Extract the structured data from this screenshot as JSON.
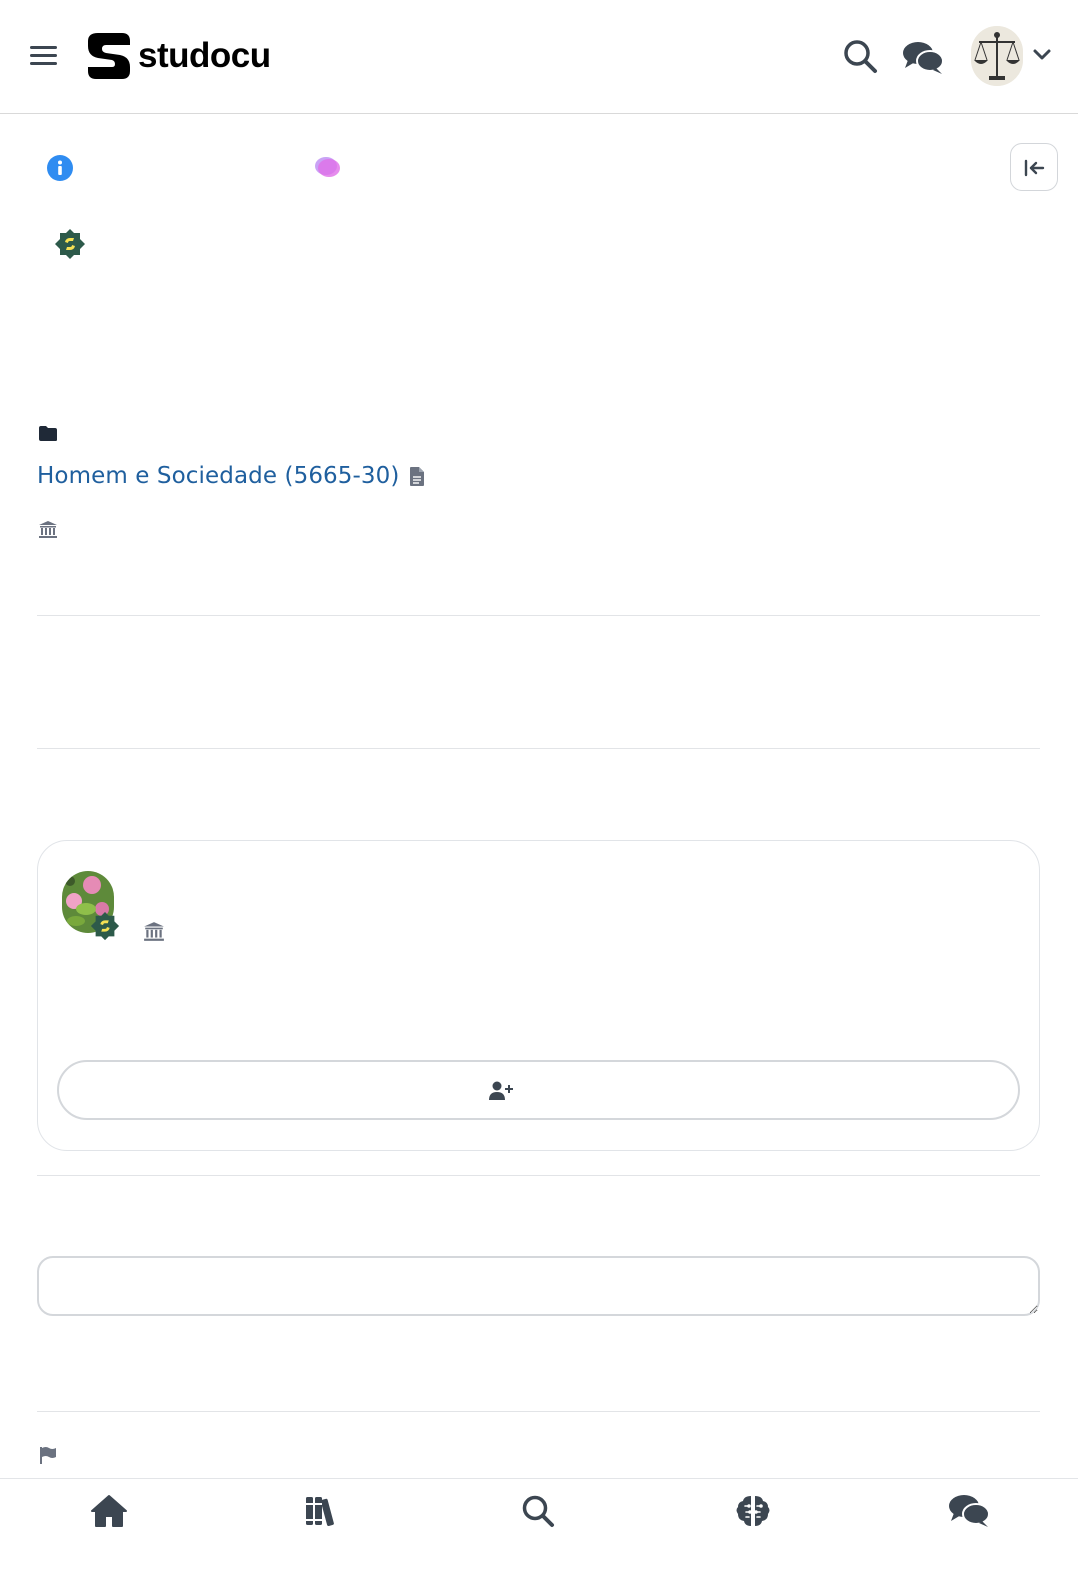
{
  "header": {
    "logo_text": "studocu",
    "icons": {
      "menu": "hamburger-menu-icon",
      "search": "search-icon",
      "chat": "chat-bubbles-icon",
      "avatar": "user-avatar",
      "dropdown": "chevron-down-icon"
    }
  },
  "document": {
    "course_link": "Homem e Sociedade (5665-30)"
  },
  "comment": {
    "placeholder": ""
  },
  "bottom_nav": {
    "items": [
      "home-icon",
      "library-icon",
      "search-icon",
      "ai-brain-icon",
      "chat-icon"
    ]
  },
  "colors": {
    "link": "#1f5f9e",
    "icon_dark": "#3c4651",
    "info_blue": "#2f8cf1",
    "badge_green": "#2d6a4f",
    "badge_yellow": "#f5e154",
    "blob_pink": "#d774f2",
    "border": "#d4d7db"
  }
}
